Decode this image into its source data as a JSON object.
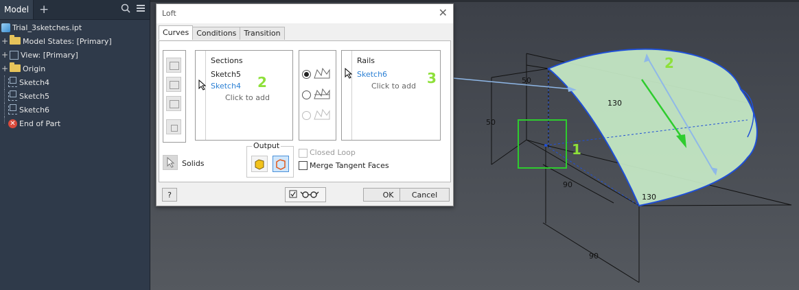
{
  "browser": {
    "tab_label": "Model",
    "add_icon": "+",
    "items": [
      {
        "label": "Trial_3sketches.ipt",
        "icon": "part-icon"
      },
      {
        "label": "Model States: [Primary]",
        "icon": "folder-icon",
        "expander": "+"
      },
      {
        "label": "View: [Primary]",
        "icon": "view-icon",
        "expander": "+"
      },
      {
        "label": "Origin",
        "icon": "folder-icon",
        "expander": "+"
      },
      {
        "label": "Sketch4",
        "icon": "sketch-icon"
      },
      {
        "label": "Sketch5",
        "icon": "sketch-icon"
      },
      {
        "label": "Sketch6",
        "icon": "sketch-icon"
      },
      {
        "label": "End of Part",
        "icon": "end-of-part-icon"
      }
    ]
  },
  "dialog": {
    "title": "Loft",
    "tabs": [
      "Curves",
      "Conditions",
      "Transition"
    ],
    "sections": {
      "header": "Sections",
      "items": [
        "Sketch5",
        "Sketch4"
      ],
      "add_prompt": "Click to add"
    },
    "rails": {
      "header": "Rails",
      "items": [
        "Sketch6"
      ],
      "add_prompt": "Click to add"
    },
    "output": {
      "label": "Output"
    },
    "solids_label": "Solids",
    "closed_loop_label": "Closed Loop",
    "merge_tangent_label": "Merge Tangent Faces",
    "ok_label": "OK",
    "cancel_label": "Cancel",
    "help_label": "?"
  },
  "annotations": {
    "marker_1": "1",
    "marker_2_dialog": "2",
    "marker_3_dialog": "3",
    "marker_2_viewport": "2"
  },
  "dimensions": {
    "d_50_top": "50",
    "d_50_left": "50",
    "d_130_top": "130",
    "d_130_bottom": "130",
    "d_90_mid": "90",
    "d_90_bottom": "90"
  },
  "colors": {
    "surface_fill": "#c8ecc8",
    "surface_edge": "#1f4fd6",
    "highlight_green": "#8ee03a",
    "accent_blue": "#2a7fd4"
  }
}
